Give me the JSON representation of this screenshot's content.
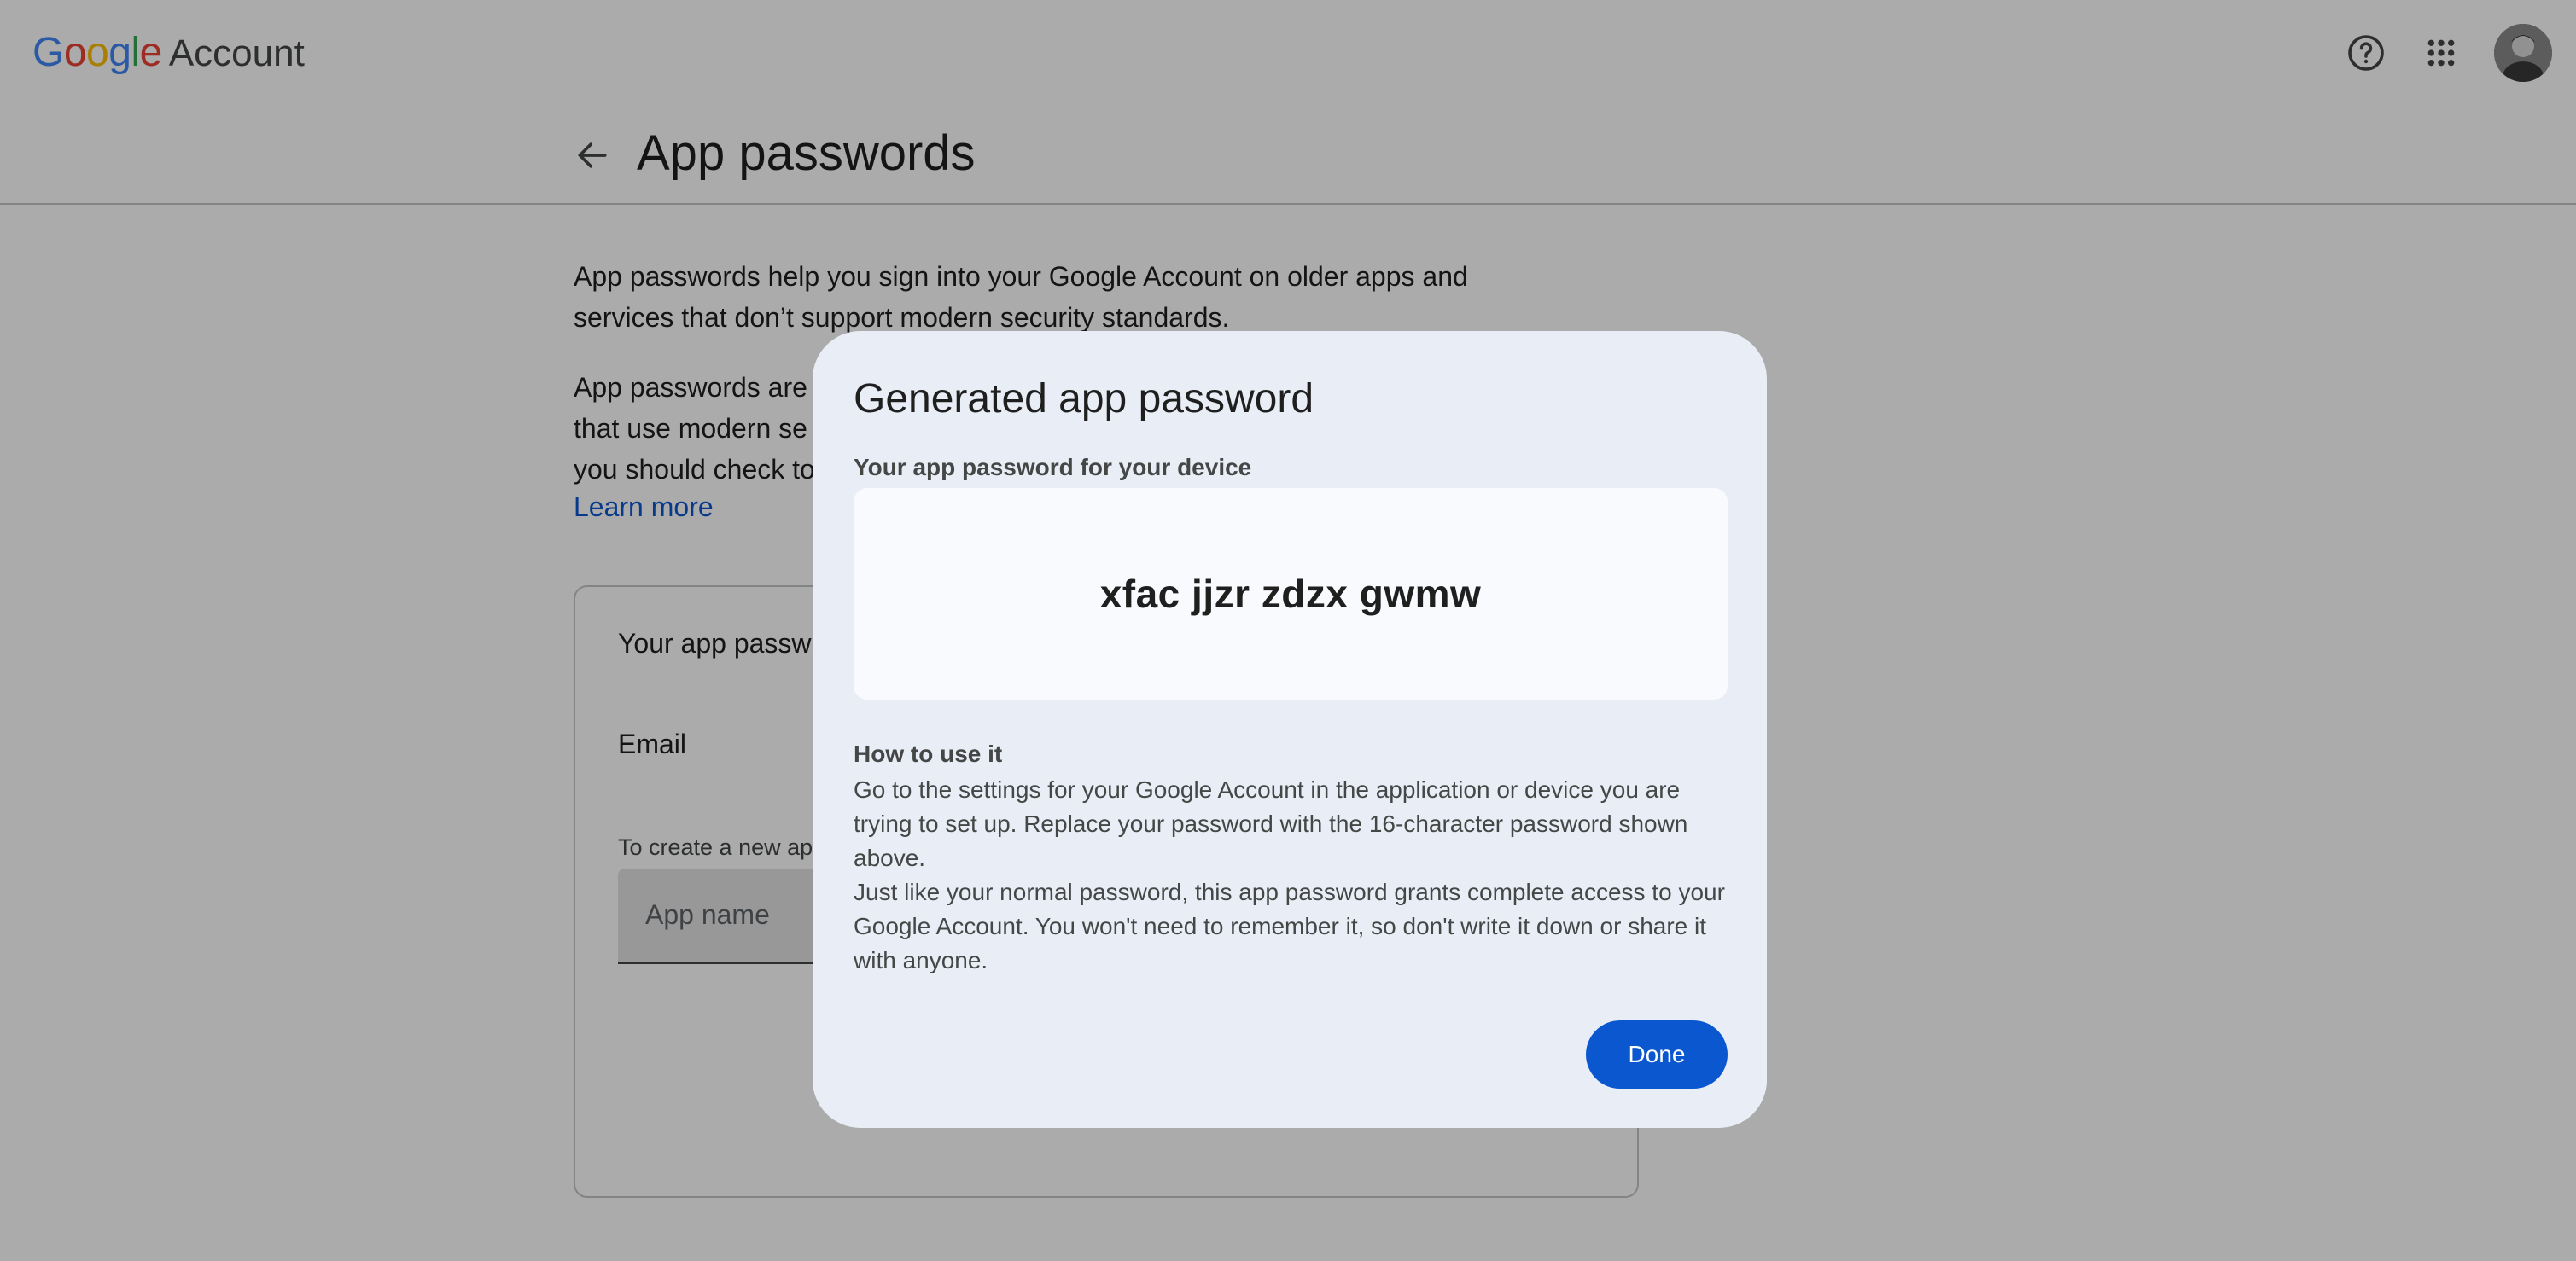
{
  "topbar": {
    "logo_letters": [
      "G",
      "o",
      "o",
      "g",
      "l",
      "e"
    ],
    "logo_colors": [
      "#4285F4",
      "#EA4335",
      "#FBBC05",
      "#4285F4",
      "#34A853",
      "#EA4335"
    ],
    "account_label": "Account",
    "icons": [
      "help-icon",
      "apps-grid-icon",
      "avatar"
    ]
  },
  "header": {
    "title": "App passwords",
    "back_icon": "arrow-back-icon"
  },
  "main": {
    "intro": "App passwords help you sign into your Google Account on older apps and services that don’t support modern security standards.",
    "para2_visible": "App passwords are",
    "para2_line2": "that use modern se",
    "para2_line3": "you should check to",
    "learn_more": "Learn more",
    "card": {
      "title": "Your app passw",
      "email_label": "Email",
      "create_hint": "To create a new ap",
      "app_name_placeholder": "App name"
    }
  },
  "dialog": {
    "title": "Generated app password",
    "subtitle": "Your app password for your device",
    "password": "xfac jjzr zdzx gwmw",
    "howto_title": "How to use it",
    "howto_p1": "Go to the settings for your Google Account in the application or device you are trying to set up. Replace your password with the 16-character password shown above.",
    "howto_p2": "Just like your normal password, this app password grants complete access to your Google Account. You won't need to remember it, so don't write it down or share it with anyone.",
    "done_label": "Done"
  },
  "colors": {
    "accent": "#0b57d0",
    "dialog_bg": "#e9eef6",
    "password_box_bg": "#f8fafd",
    "scrim": "rgba(0,0,0,0.33)"
  }
}
